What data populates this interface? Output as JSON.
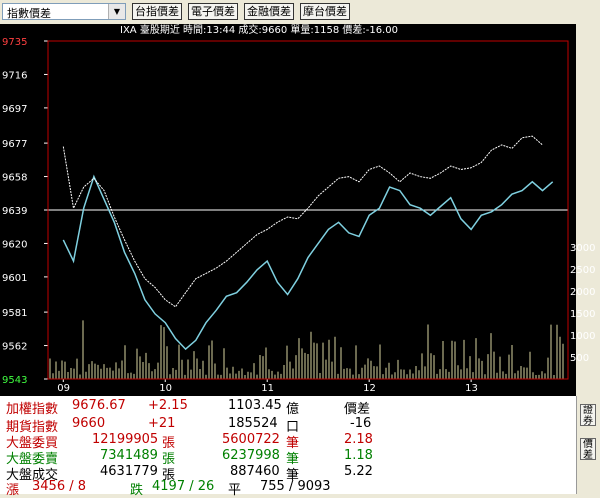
{
  "toolbar": {
    "dropdown_value": "指數價差",
    "buttons": [
      "台指價差",
      "電子價差",
      "金融價差",
      "摩台價差"
    ]
  },
  "info_bar": "IXA  臺股期近 時間:13:44 成交:9660 單量:1158 價差:-16.00",
  "colors": {
    "price_line": "#7fd0e0",
    "index_line": "#ffffff",
    "volume": "#d8d4a0",
    "top_label": "#ff4040",
    "bottom_label": "#40ff40"
  },
  "chart_data": {
    "type": "line",
    "y_ticks": [
      "9735",
      "9716",
      "9697",
      "9677",
      "9658",
      "9639",
      "9620",
      "9601",
      "9581",
      "9562",
      "9543"
    ],
    "ylim": [
      9543,
      9735
    ],
    "volume_ticks": [
      "3000",
      "2500",
      "2000",
      "1500",
      "1000",
      "500"
    ],
    "volume_lim": [
      0,
      3300
    ],
    "x_ticks": [
      "09",
      "10",
      "11",
      "12",
      "13"
    ],
    "reference_level": 9639,
    "series": [
      {
        "role": "futures",
        "x": [
          9.0,
          9.1,
          9.2,
          9.3,
          9.4,
          9.5,
          9.6,
          9.7,
          9.8,
          9.9,
          10.0,
          10.1,
          10.2,
          10.3,
          10.4,
          10.5,
          10.6,
          10.7,
          10.8,
          10.9,
          11.0,
          11.1,
          11.2,
          11.3,
          11.4,
          11.5,
          11.6,
          11.7,
          11.8,
          11.9,
          12.0,
          12.1,
          12.2,
          12.3,
          12.4,
          12.5,
          12.6,
          12.7,
          12.8,
          12.9,
          13.0,
          13.1,
          13.2,
          13.3,
          13.4,
          13.5,
          13.6,
          13.7,
          13.8
        ],
        "values": [
          9622,
          9610,
          9640,
          9658,
          9645,
          9632,
          9615,
          9603,
          9588,
          9580,
          9575,
          9566,
          9560,
          9565,
          9575,
          9582,
          9590,
          9592,
          9598,
          9605,
          9610,
          9598,
          9591,
          9600,
          9612,
          9620,
          9628,
          9632,
          9626,
          9624,
          9636,
          9640,
          9652,
          9650,
          9642,
          9640,
          9636,
          9641,
          9646,
          9634,
          9628,
          9636,
          9638,
          9642,
          9648,
          9650,
          9655,
          9650,
          9655
        ]
      },
      {
        "role": "index",
        "x": [
          9.0,
          9.1,
          9.2,
          9.3,
          9.4,
          9.5,
          9.6,
          9.7,
          9.8,
          9.9,
          10.0,
          10.1,
          10.2,
          10.3,
          10.4,
          10.5,
          10.6,
          10.7,
          10.8,
          10.9,
          11.0,
          11.1,
          11.2,
          11.3,
          11.4,
          11.5,
          11.6,
          11.7,
          11.8,
          11.9,
          12.0,
          12.1,
          12.2,
          12.3,
          12.4,
          12.5,
          12.6,
          12.7,
          12.8,
          12.9,
          13.0,
          13.1,
          13.2,
          13.3,
          13.4,
          13.5,
          13.6,
          13.7
        ],
        "values": [
          9675,
          9640,
          9652,
          9657,
          9650,
          9635,
          9622,
          9610,
          9600,
          9595,
          9588,
          9584,
          9592,
          9600,
          9603,
          9606,
          9610,
          9615,
          9620,
          9625,
          9628,
          9632,
          9635,
          9634,
          9640,
          9647,
          9652,
          9657,
          9658,
          9655,
          9662,
          9664,
          9660,
          9655,
          9660,
          9658,
          9657,
          9660,
          9664,
          9662,
          9663,
          9666,
          9673,
          9676,
          9674,
          9680,
          9681,
          9676
        ]
      }
    ]
  },
  "rows": [
    {
      "label": "加權指數",
      "v1": "9676.67",
      "v2": "+2.15",
      "v3": "1103.45",
      "unit": "億",
      "v4": "價差"
    },
    {
      "label": "期貨指數",
      "v1": "9660",
      "v2": "+21",
      "v3": "185524",
      "unit": "口",
      "v4": "-16"
    },
    {
      "label": "大盤委買",
      "v1": "12199905",
      "unit1": "張",
      "v3": "5600722",
      "unit": "筆",
      "v4": "2.18"
    },
    {
      "label": "大盤委賣",
      "v1": "7341489",
      "unit1": "張",
      "v3": "6237998",
      "unit": "筆",
      "v4": "1.18"
    },
    {
      "label": "大盤成交",
      "v1": "4631779",
      "unit1": "張",
      "v3": "887460",
      "unit": "筆",
      "v4": "5.22"
    }
  ],
  "breadth": {
    "up_label": "漲",
    "up": "3456 / 8",
    "down_label": "跌",
    "down": "4197 / 26",
    "flat_label": "平",
    "flat": "755 / 9093"
  },
  "side_buttons": [
    "證券",
    "價差"
  ]
}
